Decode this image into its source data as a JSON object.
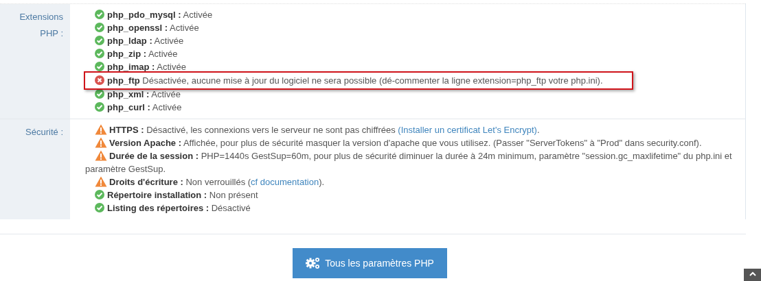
{
  "sections": [
    {
      "label": "Extensions PHP :",
      "items": [
        {
          "kind": "ok",
          "highlighted": false,
          "text": "**php_pdo_mysql :** Activée"
        },
        {
          "kind": "ok",
          "highlighted": false,
          "text": "**php_openssl :** Activée"
        },
        {
          "kind": "ok",
          "highlighted": false,
          "text": "**php_ldap :** Activée"
        },
        {
          "kind": "ok",
          "highlighted": false,
          "text": "**php_zip :** Activée"
        },
        {
          "kind": "ok",
          "highlighted": false,
          "text": "**php_imap :** Activée"
        },
        {
          "kind": "error",
          "highlighted": true,
          "text": "**php_ftp** Désactivée, aucune mise à jour du logiciel ne sera possible (dé-commenter la ligne extension=php_ftp votre php.ini)."
        },
        {
          "kind": "ok",
          "highlighted": false,
          "text": "**php_xml :** Activée"
        },
        {
          "kind": "ok",
          "highlighted": false,
          "text": "**php_curl :** Activée"
        }
      ]
    },
    {
      "label": "Sécurité :",
      "items": [
        {
          "kind": "warning",
          "highlighted": false,
          "text": "**HTTPS :** Désactivé, les connexions vers le serveur ne sont pas chiffrées ",
          "link": "(Installer un certificat Let's Encrypt)",
          "after": "."
        },
        {
          "kind": "warning",
          "highlighted": false,
          "text": "**Version Apache :** Affichée, pour plus de sécurité masquer la version d'apache que vous utilisez. (Passer \"ServerTokens\" à \"Prod\" dans security.conf)."
        },
        {
          "kind": "warning",
          "highlighted": false,
          "text": "**Durée de la session :** PHP=1440s GestSup=60m, pour plus de sécurité diminuer la durée à 24m minimum, paramètre \"session.gc_maxlifetime\" du php.ini et paramètre GestSup."
        },
        {
          "kind": "warning",
          "highlighted": false,
          "text": "**Droits d'écriture :** Non verrouillés (",
          "link": "cf documentation",
          "after": ")."
        },
        {
          "kind": "ok",
          "highlighted": false,
          "text": "**Répertoire installation :** Non présent"
        },
        {
          "kind": "ok",
          "highlighted": false,
          "text": "**Listing des répertoires :** Désactivé"
        }
      ]
    }
  ],
  "button": {
    "label": "Tous les paramètres PHP"
  }
}
